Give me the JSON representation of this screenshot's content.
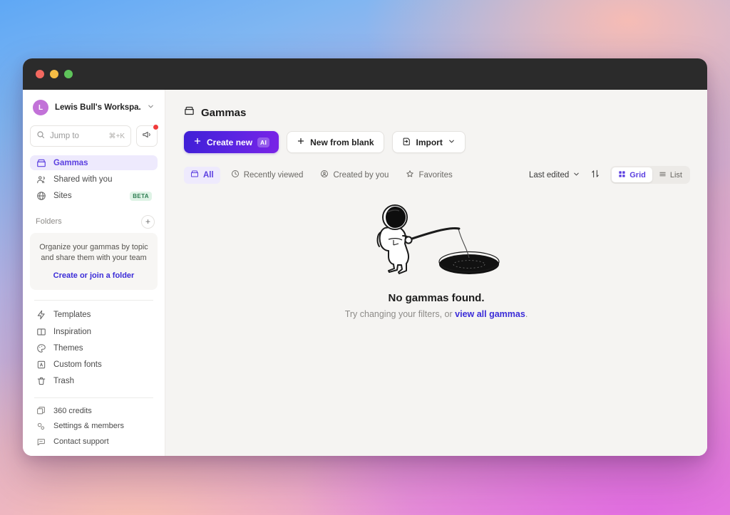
{
  "window": {
    "traffic_lights": [
      "close",
      "minimize",
      "zoom"
    ]
  },
  "sidebar": {
    "workspace": {
      "avatar_letter": "L",
      "name": "Lewis Bull's Workspa...",
      "chevron": "⌄"
    },
    "search": {
      "placeholder": "Jump to",
      "shortcut": "⌘+K"
    },
    "announcements_icon": "megaphone-icon",
    "nav_primary": [
      {
        "label": "Gammas",
        "icon": "archive-icon",
        "active": true
      },
      {
        "label": "Shared with you",
        "icon": "people-icon",
        "active": false
      },
      {
        "label": "Sites",
        "icon": "globe-icon",
        "active": false,
        "badge": "BETA"
      }
    ],
    "folders": {
      "title": "Folders",
      "add_label": "+",
      "promo_text": "Organize your gammas by topic and share them with your team",
      "promo_link": "Create or join a folder"
    },
    "nav_secondary": [
      {
        "label": "Templates",
        "icon": "lightning-icon"
      },
      {
        "label": "Inspiration",
        "icon": "book-icon"
      },
      {
        "label": "Themes",
        "icon": "palette-icon"
      },
      {
        "label": "Custom fonts",
        "icon": "font-icon"
      },
      {
        "label": "Trash",
        "icon": "trash-icon"
      }
    ],
    "nav_footer": [
      {
        "label": "360 credits",
        "icon": "credits-icon"
      },
      {
        "label": "Settings & members",
        "icon": "gear-icon"
      },
      {
        "label": "Contact support",
        "icon": "chat-icon"
      }
    ]
  },
  "main": {
    "page_title": "Gammas",
    "page_title_icon": "archive-icon",
    "actions": [
      {
        "label": "Create new",
        "icon": "plus-icon",
        "chip": "AI",
        "primary": true
      },
      {
        "label": "New from blank",
        "icon": "plus-icon",
        "primary": false
      },
      {
        "label": "Import",
        "icon": "import-icon",
        "chevron": "⌄",
        "primary": false
      }
    ],
    "tabs": [
      {
        "label": "All",
        "icon": "archive-icon",
        "active": true
      },
      {
        "label": "Recently viewed",
        "icon": "clock-icon",
        "active": false
      },
      {
        "label": "Created by you",
        "icon": "user-circle-icon",
        "active": false
      },
      {
        "label": "Favorites",
        "icon": "star-icon",
        "active": false
      }
    ],
    "sort": {
      "label": "Last edited",
      "chevron": "⌄",
      "direction_icon": "sort-arrows-icon"
    },
    "view_toggle": [
      {
        "label": "Grid",
        "icon": "grid-icon",
        "active": true
      },
      {
        "label": "List",
        "icon": "list-icon",
        "active": false
      }
    ],
    "empty_state": {
      "illustration": "astronaut-fishing-black-hole-illustration",
      "title": "No gammas found.",
      "subtitle_prefix": "Try changing your filters, or ",
      "subtitle_link": "view all gammas",
      "subtitle_suffix": "."
    }
  },
  "colors": {
    "accent": "#5b3fe0",
    "link": "#3b2cd8",
    "primary_button_start": "#3f1fd6",
    "primary_button_end": "#7a23e6",
    "beta_badge_bg": "#dff3e6",
    "beta_badge_text": "#2e7d52",
    "notification_dot": "#f03b3b",
    "avatar": "#c272d8"
  }
}
